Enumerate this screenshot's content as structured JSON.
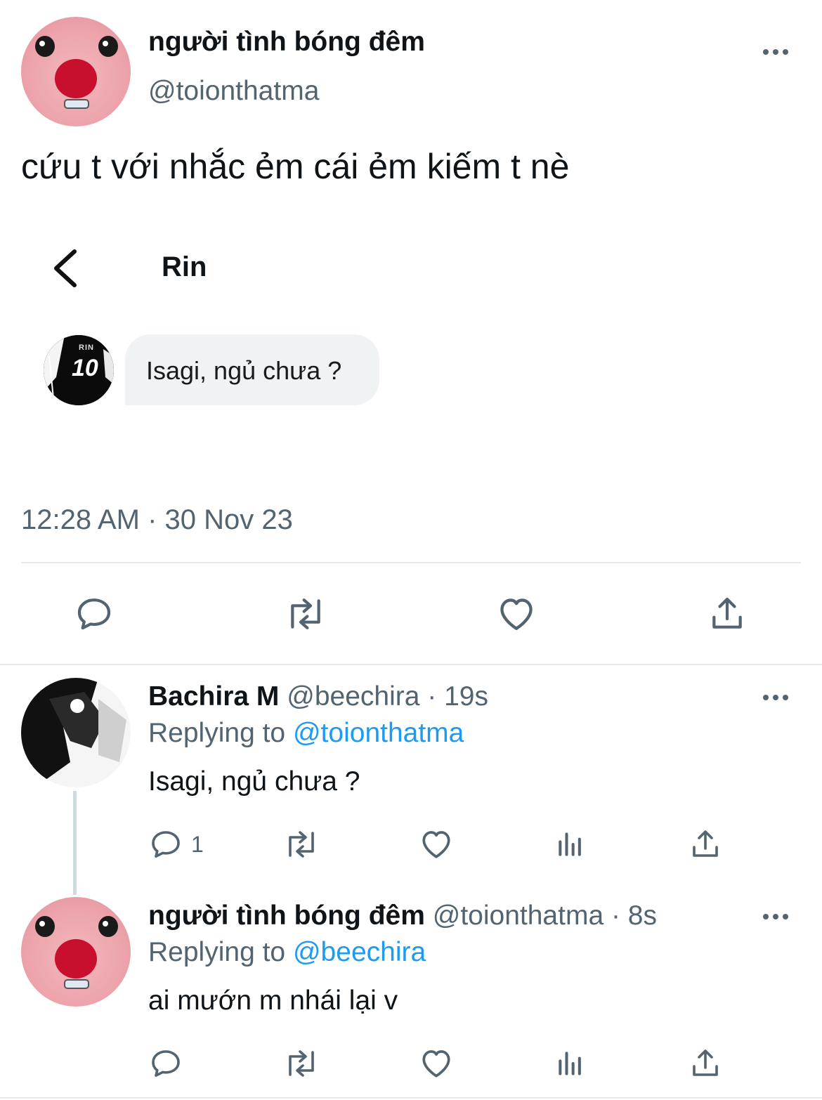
{
  "main_tweet": {
    "display_name": "người tình bóng đêm",
    "handle": "@toionthatma",
    "text": "cứu t với nhắc ẻm cái ẻm kiếm t nè",
    "timestamp": "12:28 AM · 30 Nov 23"
  },
  "embedded_chat": {
    "contact_name": "Rin",
    "avatar_badge": "10",
    "avatar_small_text": "RIN",
    "message": "Isagi, ngủ chưa ?"
  },
  "replies": [
    {
      "display_name": "Bachira M",
      "handle": "@beechira",
      "time": "· 19s",
      "replying_label": "Replying to",
      "replying_to": "@toionthatma",
      "text": "Isagi, ngủ chưa ?",
      "reply_count": "1"
    },
    {
      "display_name": "người tình bóng đêm",
      "handle": "@toionthatma",
      "time": "· 8s",
      "replying_label": "Replying to",
      "replying_to": "@beechira",
      "text": "ai mướn m nhái lại v",
      "reply_count": ""
    }
  ],
  "icons": [
    "more-icon",
    "back-chevron-icon",
    "reply-icon",
    "retweet-icon",
    "like-icon",
    "share-icon",
    "views-icon"
  ],
  "colors": {
    "text": "#0f1419",
    "secondary": "#536471",
    "link": "#1d9bf0",
    "bubble": "#eff3f4",
    "divider": "#e6e9eb"
  }
}
